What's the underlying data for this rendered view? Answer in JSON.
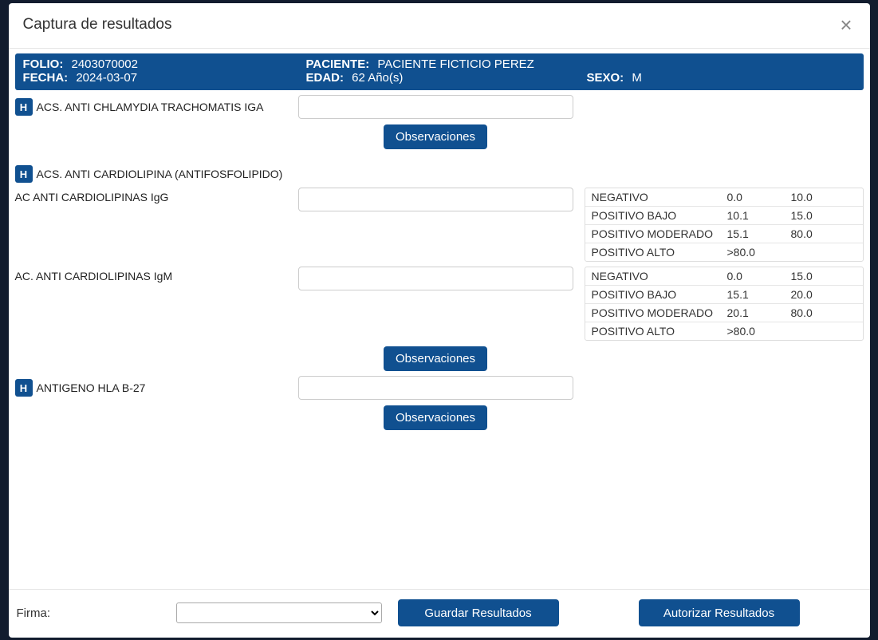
{
  "modal": {
    "title": "Captura de resultados"
  },
  "info": {
    "folio_label": "FOLIO:",
    "folio_value": "2403070002",
    "fecha_label": "FECHA:",
    "fecha_value": "2024-03-07",
    "paciente_label": "PACIENTE:",
    "paciente_value": "PACIENTE FICTICIO PEREZ",
    "edad_label": "EDAD:",
    "edad_value": "62 Año(s)",
    "sexo_label": "SEXO:",
    "sexo_value": "M"
  },
  "badge_h": "H",
  "buttons": {
    "observaciones": "Observaciones",
    "guardar": "Guardar Resultados",
    "autorizar": "Autorizar Resultados"
  },
  "tests": {
    "t1": {
      "name": "ACS. ANTI CHLAMYDIA TRACHOMATIS IGA"
    },
    "t2": {
      "name": "ACS. ANTI CARDIOLIPINA (ANTIFOSFOLIPIDO)"
    },
    "t2a": {
      "name": "AC ANTI CARDIOLIPINAS IgG"
    },
    "t2b": {
      "name": "AC. ANTI CARDIOLIPINAS IgM"
    },
    "t3": {
      "name": "ANTIGENO HLA B-27"
    }
  },
  "ref_igg": [
    {
      "label": "NEGATIVO",
      "low": "0.0",
      "high": "10.0"
    },
    {
      "label": "POSITIVO BAJO",
      "low": "10.1",
      "high": "15.0"
    },
    {
      "label": "POSITIVO MODERADO",
      "low": "15.1",
      "high": "80.0"
    },
    {
      "label": "POSITIVO ALTO",
      "low": ">80.0",
      "high": ""
    }
  ],
  "ref_igm": [
    {
      "label": "NEGATIVO",
      "low": "0.0",
      "high": "15.0"
    },
    {
      "label": "POSITIVO BAJO",
      "low": "15.1",
      "high": "20.0"
    },
    {
      "label": "POSITIVO MODERADO",
      "low": "20.1",
      "high": "80.0"
    },
    {
      "label": "POSITIVO ALTO",
      "low": ">80.0",
      "high": ""
    }
  ],
  "footer": {
    "firma_label": "Firma:"
  }
}
